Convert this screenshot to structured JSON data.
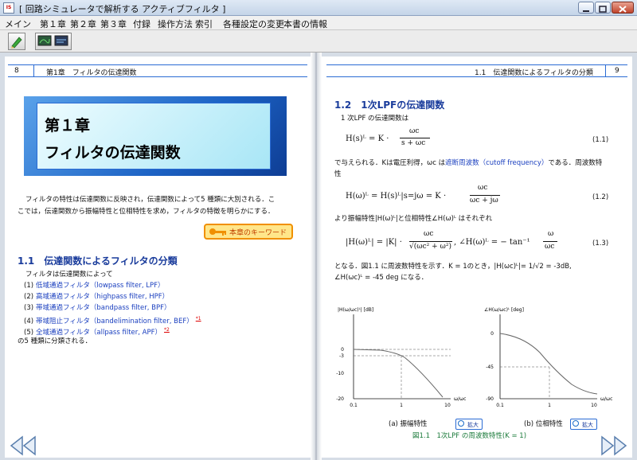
{
  "window": {
    "title": "[ 回路シミュレータで解析する アクティブフィルタ ]"
  },
  "menu": [
    "メイン",
    "第１章",
    "第２章",
    "第３章",
    "付録",
    "操作方法",
    "索引",
    "各種設定の変更",
    "本書の情報"
  ],
  "toolbar": {
    "buttons": [
      "pen-tool-icon",
      "monitor-icon"
    ]
  },
  "left_page": {
    "header_num": "8",
    "header_title": "第1章　フィルタの伝達関数",
    "chapter_num": "第１章",
    "chapter_title": "フィルタの伝達関数",
    "intro_line1": "フィルタの特性は伝達関数に反映され，伝達関数によって5 種類に大別される．こ",
    "intro_line2": "こでは，伝達関数から振幅特性と位相特性を求め，フィルタの特徴を明らかにする．",
    "keyword_button": "本章のキーワード",
    "section_heading": "1.1　伝達関数によるフィルタの分類",
    "list_intro": "フィルタは伝達関数によって",
    "items": [
      {
        "num": "(1)",
        "name": "低域通過フィルタ",
        "en": "（lowpass filter, LPF）",
        "note": ""
      },
      {
        "num": "(2)",
        "name": "高域通過フィルタ",
        "en": "（highpass filter, HPF）",
        "note": ""
      },
      {
        "num": "(3)",
        "name": "帯域通過フィルタ",
        "en": "（bandpass filter, BPF）",
        "note": ""
      },
      {
        "num": "(4)",
        "name": "帯域阻止フィルタ",
        "en": "（bandelimination filter, BEF）",
        "note": "*1"
      },
      {
        "num": "(5)",
        "name": "全域通過フィルタ",
        "en": "（allpass filter, APF）",
        "note": "*2"
      }
    ],
    "list_outro": "の5 種類に分類される．"
  },
  "right_page": {
    "header_title": "1.1　伝達関数によるフィルタの分類",
    "header_num": "9",
    "section_heading": "1.2　1次LPFの伝達関数",
    "line1": "1 次LPF の伝達関数は",
    "eq1_lhs": "H(s)ᴸ = K ·",
    "eq1_num": "ωc",
    "eq1_den": "s + ωc",
    "eq1_no": "(1.1)",
    "line2_a": "で与えられる．Kは電圧利得，ωc は",
    "line2_link": "遮断周波数（cutoff frequency）",
    "line2_b": "である．周波数特",
    "line3": "性",
    "eq2_lhs": "H(ω)ᴸ = H(s)ᴸ|s=jω = K ·",
    "eq2_num": "ωc",
    "eq2_den": "ωc + jω",
    "eq2_no": "(1.2)",
    "line4": "より振幅特性|H(ω)ᴸ|と位相特性∠H(ω)ᴸ はそれぞれ",
    "eq3_lhs": "|H(ω)ᴸ| = |K| ·",
    "eq3_num": "ωc",
    "eq3_den": "√(ωc² + ω²)",
    "eq3_mid": ",   ∠H(ω)ᴸ = − tan⁻¹",
    "eq3_num2": "ω",
    "eq3_den2": "ωc",
    "eq3_no": "(1.3)",
    "line5": "となる．図1.1 に周波数特性を示す．K = 1のとき，|H(ωc)ᴸ|= 1/√2 = -3dB,",
    "line6": "∠H(ωc)ᴸ = -45 deg になる．",
    "graph_a": {
      "ylabel": "|H(ω/ωc)ᴸ| [dB]",
      "xlabel": "ω/ωc",
      "yticks": [
        "0",
        "-3",
        "-10",
        "-20"
      ],
      "xticks": [
        "0.1",
        "1",
        "10"
      ],
      "caption": "(a) 振幅特性"
    },
    "graph_b": {
      "ylabel": "∠H(ω/ωc)ᴸ [deg]",
      "xlabel": "ω/ωc",
      "yticks": [
        "0",
        "-45",
        "-90"
      ],
      "xticks": [
        "0.1",
        "1",
        "10"
      ],
      "caption": "(b) 位相特性"
    },
    "zoom_label": "拡大",
    "figure_caption": "図1.1　1次LPF の周波数特性(K = 1)"
  },
  "colors": {
    "accent": "#2a6bd4",
    "heading": "#1a3c9c",
    "link": "#1a3fbf",
    "keyword": "#f09000"
  }
}
